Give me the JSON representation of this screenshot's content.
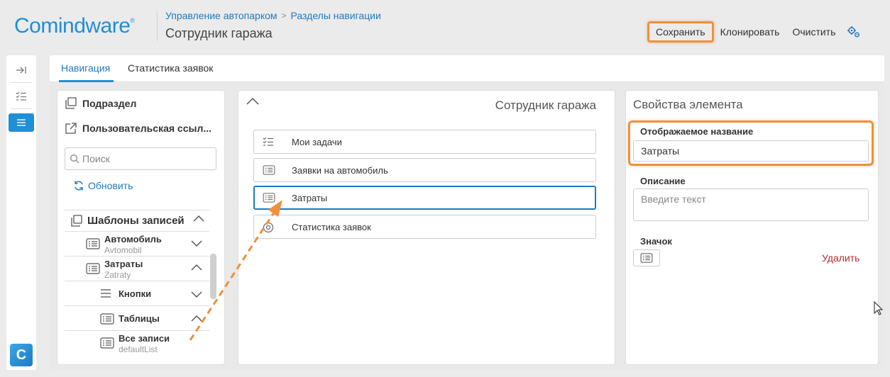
{
  "header": {
    "logo": "Comindware",
    "logo_reg": "®",
    "breadcrumb": [
      "Управление автопарком",
      "Разделы навигации"
    ],
    "breadcrumb_sep": ">",
    "title": "Сотрудник гаража",
    "actions": {
      "save": "Сохранить",
      "clone": "Клонировать",
      "clear": "Очистить"
    }
  },
  "rail": {
    "logo_letter": "C"
  },
  "tabs": [
    {
      "label": "Навигация",
      "active": true
    },
    {
      "label": "Статистика заявок",
      "active": false
    }
  ],
  "left_panel": {
    "items": [
      "Подраздел",
      "Пользовательская ссыл..."
    ],
    "search_placeholder": "Поиск",
    "refresh": "Обновить",
    "templates_header": "Шаблоны записей",
    "tree": [
      {
        "title": "Автомобиль",
        "sub": "Avtomobil",
        "expanded": false
      },
      {
        "title": "Затраты",
        "sub": "Zatraty",
        "expanded": true
      },
      {
        "title": "Кнопки",
        "sub": "",
        "expanded": false
      },
      {
        "title": "Таблицы",
        "sub": "",
        "expanded": true
      },
      {
        "title": "Все записи",
        "sub": "defaultList",
        "expanded": null
      }
    ]
  },
  "middle_panel": {
    "title": "Сотрудник гаража",
    "items": [
      {
        "label": "Мои задачи",
        "icon": "tasks-icon",
        "selected": false
      },
      {
        "label": "Заявки на автомобиль",
        "icon": "list-icon",
        "selected": false
      },
      {
        "label": "Затраты",
        "icon": "list-icon",
        "selected": true
      },
      {
        "label": "Статистика заявок",
        "icon": "chart-icon",
        "selected": false
      }
    ]
  },
  "right_panel": {
    "title": "Свойства элемента",
    "display_name_label": "Отображаемое название",
    "display_name_value": "Затраты",
    "description_label": "Описание",
    "description_placeholder": "Введите текст",
    "icon_label": "Значок",
    "delete": "Удалить"
  },
  "colors": {
    "accent": "#1f8fd6",
    "highlight": "#f0903c",
    "danger": "#b22b2b"
  }
}
